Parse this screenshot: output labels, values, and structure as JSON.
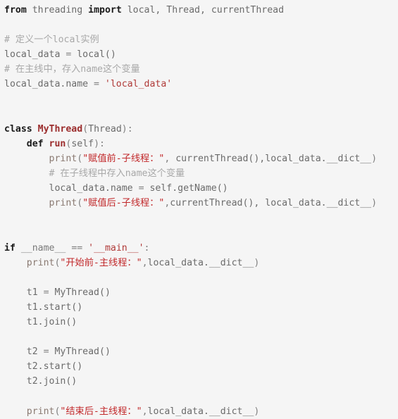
{
  "document": {
    "kind": "python-source-code",
    "background_color": "#f5f5f5",
    "theme": {
      "keyword_color": "#1a1a1a",
      "definition_name_color": "#9b2c2c",
      "identifier_color": "#6b6b6b",
      "string_color": "#b03a38",
      "string_cjk_color": "#c1282a",
      "comment_color": "#a8a8a8",
      "builtin_color": "#8a7a72"
    },
    "lines": [
      {
        "n": 1,
        "text": "from threading import local, Thread, currentThread",
        "tokens": [
          {
            "t": "from",
            "c": "kw"
          },
          {
            "t": " ",
            "c": "plain"
          },
          {
            "t": "threading",
            "c": "ident"
          },
          {
            "t": " ",
            "c": "plain"
          },
          {
            "t": "import",
            "c": "kw"
          },
          {
            "t": " ",
            "c": "plain"
          },
          {
            "t": "local, Thread, currentThread",
            "c": "ident"
          }
        ]
      },
      {
        "n": 2,
        "text": "",
        "tokens": []
      },
      {
        "n": 3,
        "text": "# 定义一个local实例",
        "tokens": [
          {
            "t": "# 定义一个local实例",
            "c": "comment"
          }
        ]
      },
      {
        "n": 4,
        "text": "local_data = local()",
        "tokens": [
          {
            "t": "local_data",
            "c": "ident"
          },
          {
            "t": " = ",
            "c": "punct"
          },
          {
            "t": "local()",
            "c": "ident"
          }
        ]
      },
      {
        "n": 5,
        "text": "# 在主线中，存入name这个变量",
        "tokens": [
          {
            "t": "# 在主线中，存入name这个变量",
            "c": "comment"
          }
        ]
      },
      {
        "n": 6,
        "text": "local_data.name = 'local_data'",
        "tokens": [
          {
            "t": "local_data.name",
            "c": "ident"
          },
          {
            "t": " = ",
            "c": "punct"
          },
          {
            "t": "'local_data'",
            "c": "str"
          }
        ]
      },
      {
        "n": 7,
        "text": "",
        "tokens": []
      },
      {
        "n": 8,
        "text": "",
        "tokens": []
      },
      {
        "n": 9,
        "text": "class MyThread(Thread):",
        "tokens": [
          {
            "t": "class",
            "c": "kw"
          },
          {
            "t": " ",
            "c": "plain"
          },
          {
            "t": "MyThread",
            "c": "name"
          },
          {
            "t": "(",
            "c": "punct"
          },
          {
            "t": "Thread",
            "c": "ident"
          },
          {
            "t": "):",
            "c": "punct"
          }
        ]
      },
      {
        "n": 10,
        "text": "    def run(self):",
        "tokens": [
          {
            "t": "    ",
            "c": "plain"
          },
          {
            "t": "def",
            "c": "kw"
          },
          {
            "t": " ",
            "c": "plain"
          },
          {
            "t": "run",
            "c": "name"
          },
          {
            "t": "(",
            "c": "punct"
          },
          {
            "t": "self",
            "c": "ident"
          },
          {
            "t": "):",
            "c": "punct"
          }
        ]
      },
      {
        "n": 11,
        "text": "        print(\"赋值前-子线程：\", currentThread(),local_data.__dict__)",
        "tokens": [
          {
            "t": "        ",
            "c": "plain"
          },
          {
            "t": "print",
            "c": "builtin"
          },
          {
            "t": "(",
            "c": "punct"
          },
          {
            "t": "\"赋值前-子线程：\"",
            "c": "str-cn"
          },
          {
            "t": ", ",
            "c": "punct"
          },
          {
            "t": "currentThread(),local_data.__dict__",
            "c": "ident"
          },
          {
            "t": ")",
            "c": "punct"
          }
        ]
      },
      {
        "n": 12,
        "text": "        # 在子线程中存入name这个变量",
        "tokens": [
          {
            "t": "        ",
            "c": "plain"
          },
          {
            "t": "# 在子线程中存入name这个变量",
            "c": "comment"
          }
        ]
      },
      {
        "n": 13,
        "text": "        local_data.name = self.getName()",
        "tokens": [
          {
            "t": "        ",
            "c": "plain"
          },
          {
            "t": "local_data.name",
            "c": "ident"
          },
          {
            "t": " = ",
            "c": "punct"
          },
          {
            "t": "self.getName()",
            "c": "ident"
          }
        ]
      },
      {
        "n": 14,
        "text": "        print(\"赋值后-子线程：\",currentThread(), local_data.__dict__)",
        "tokens": [
          {
            "t": "        ",
            "c": "plain"
          },
          {
            "t": "print",
            "c": "builtin"
          },
          {
            "t": "(",
            "c": "punct"
          },
          {
            "t": "\"赋值后-子线程：\"",
            "c": "str-cn"
          },
          {
            "t": ",",
            "c": "punct"
          },
          {
            "t": "currentThread(), local_data.__dict__",
            "c": "ident"
          },
          {
            "t": ")",
            "c": "punct"
          }
        ]
      },
      {
        "n": 15,
        "text": "",
        "tokens": []
      },
      {
        "n": 16,
        "text": "",
        "tokens": []
      },
      {
        "n": 17,
        "text": "if __name__ == '__main__':",
        "tokens": [
          {
            "t": "if",
            "c": "kw"
          },
          {
            "t": " ",
            "c": "plain"
          },
          {
            "t": "__name__",
            "c": "dunder"
          },
          {
            "t": " == ",
            "c": "punct"
          },
          {
            "t": "'__main__'",
            "c": "str"
          },
          {
            "t": ":",
            "c": "punct"
          }
        ]
      },
      {
        "n": 18,
        "text": "    print(\"开始前-主线程：\",local_data.__dict__)",
        "tokens": [
          {
            "t": "    ",
            "c": "plain"
          },
          {
            "t": "print",
            "c": "builtin"
          },
          {
            "t": "(",
            "c": "punct"
          },
          {
            "t": "\"开始前-主线程：\"",
            "c": "str-cn"
          },
          {
            "t": ",",
            "c": "punct"
          },
          {
            "t": "local_data.__dict__",
            "c": "ident"
          },
          {
            "t": ")",
            "c": "punct"
          }
        ]
      },
      {
        "n": 19,
        "text": "",
        "tokens": []
      },
      {
        "n": 20,
        "text": "    t1 = MyThread()",
        "tokens": [
          {
            "t": "    ",
            "c": "plain"
          },
          {
            "t": "t1",
            "c": "ident"
          },
          {
            "t": " = ",
            "c": "punct"
          },
          {
            "t": "MyThread()",
            "c": "ident"
          }
        ]
      },
      {
        "n": 21,
        "text": "    t1.start()",
        "tokens": [
          {
            "t": "    ",
            "c": "plain"
          },
          {
            "t": "t1.start()",
            "c": "ident"
          }
        ]
      },
      {
        "n": 22,
        "text": "    t1.join()",
        "tokens": [
          {
            "t": "    ",
            "c": "plain"
          },
          {
            "t": "t1.join()",
            "c": "ident"
          }
        ]
      },
      {
        "n": 23,
        "text": "",
        "tokens": []
      },
      {
        "n": 24,
        "text": "    t2 = MyThread()",
        "tokens": [
          {
            "t": "    ",
            "c": "plain"
          },
          {
            "t": "t2",
            "c": "ident"
          },
          {
            "t": " = ",
            "c": "punct"
          },
          {
            "t": "MyThread()",
            "c": "ident"
          }
        ]
      },
      {
        "n": 25,
        "text": "    t2.start()",
        "tokens": [
          {
            "t": "    ",
            "c": "plain"
          },
          {
            "t": "t2.start()",
            "c": "ident"
          }
        ]
      },
      {
        "n": 26,
        "text": "    t2.join()",
        "tokens": [
          {
            "t": "    ",
            "c": "plain"
          },
          {
            "t": "t2.join()",
            "c": "ident"
          }
        ]
      },
      {
        "n": 27,
        "text": "",
        "tokens": []
      },
      {
        "n": 28,
        "text": "    print(\"结束后-主线程：\",local_data.__dict__)",
        "tokens": [
          {
            "t": "    ",
            "c": "plain"
          },
          {
            "t": "print",
            "c": "builtin"
          },
          {
            "t": "(",
            "c": "punct"
          },
          {
            "t": "\"结束后-主线程：\"",
            "c": "str-cn"
          },
          {
            "t": ",",
            "c": "punct"
          },
          {
            "t": "local_data.__dict__",
            "c": "ident"
          },
          {
            "t": ")",
            "c": "punct"
          }
        ]
      }
    ]
  }
}
